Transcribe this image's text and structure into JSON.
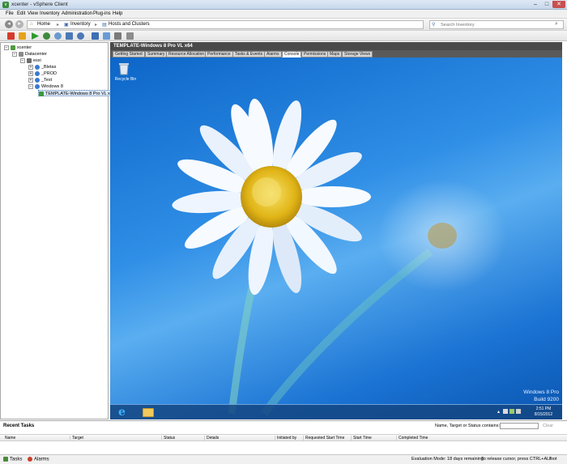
{
  "window": {
    "title": "xcenter - vSphere Client",
    "app_icon": "vsphere-app-icon",
    "min": "–",
    "max": "□",
    "close": "✕"
  },
  "menu": [
    "File",
    "Edit",
    "View",
    "Inventory",
    "Administration",
    "Plug-ins",
    "Help"
  ],
  "breadcrumb": {
    "home": "Home",
    "inventory": "Inventory",
    "section": "Hosts and Clusters"
  },
  "search": {
    "placeholder": "Search Inventory"
  },
  "tree": {
    "root": "xcenter",
    "datacenter": "Datacenter",
    "host": "esxi",
    "folders": [
      "_Bletas",
      "_PROD",
      "_Test",
      "Windows 8"
    ],
    "vm": "TEMPLATE-Windows 8 Pro VL x64"
  },
  "vm": {
    "title": "TEMPLATE-Windows 8 Pro VL x64",
    "tabs": [
      "Getting Started",
      "Summary",
      "Resource Allocation",
      "Performance",
      "Tasks & Events",
      "Alarms",
      "Console",
      "Permissions",
      "Maps",
      "Storage Views"
    ],
    "active_tab": "Console"
  },
  "desktop": {
    "recycle_bin": "Recycle Bin",
    "edition": "Windows 8 Pro",
    "build": "Build 9200",
    "time": "2:51 PM",
    "date": "8/15/2012"
  },
  "recent_tasks": {
    "title": "Recent Tasks",
    "filter_label": "Name, Target or Status contains: ▾",
    "clear": "Clear",
    "columns": [
      "Name",
      "Target",
      "Status",
      "Details",
      "Initiated by",
      "Requested Start Time",
      "Start Time",
      "Completed Time"
    ]
  },
  "status": {
    "tasks": "Tasks",
    "alarms": "Alarms",
    "evaluation": "Evaluation Mode: 18 days remaining",
    "release": "To release cursor, press CTRL+ALT",
    "user": "root"
  },
  "colors": {
    "titlebar": "#c6d7ec",
    "console_bg": "#2f8ee6",
    "close": "#c75050"
  }
}
